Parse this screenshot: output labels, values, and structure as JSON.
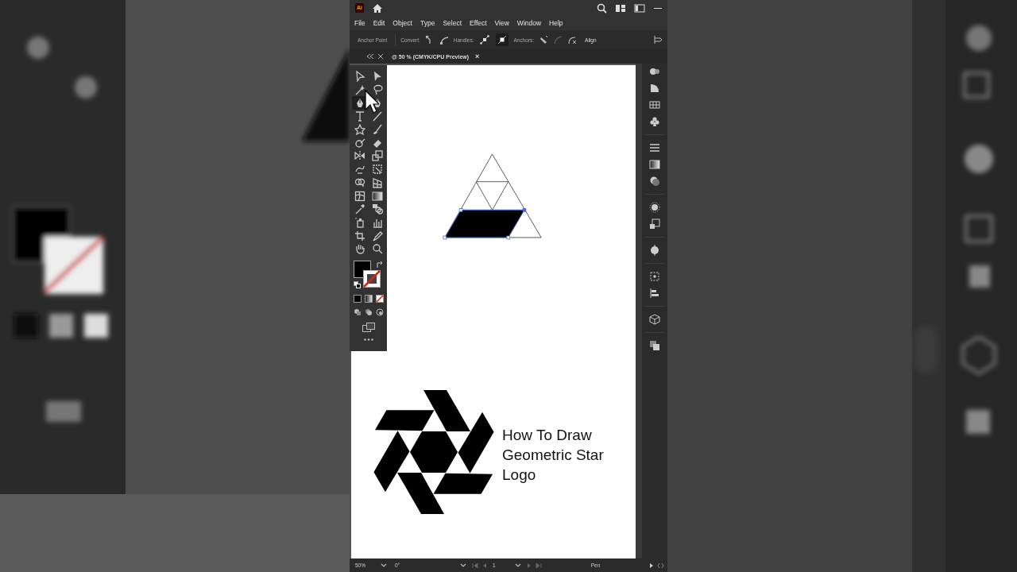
{
  "title_bar": {
    "app_badge": "Ai"
  },
  "menu": [
    "File",
    "Edit",
    "Object",
    "Type",
    "Select",
    "Effect",
    "View",
    "Window",
    "Help"
  ],
  "control_bar": {
    "label": "Anchor Point",
    "convert_label": "Convert:",
    "handles_label": "Handles:",
    "handles": [
      {
        "selected": false
      },
      {
        "selected": true
      }
    ],
    "anchors_label": "Anchors:",
    "align": "Align"
  },
  "document_tab": {
    "title": "@ 50 % (CMYK/CPU Preview)",
    "close": "×"
  },
  "tools": [
    {
      "kind": "selection",
      "selected": false
    },
    {
      "kind": "direct",
      "selected": false
    },
    {
      "kind": "wand",
      "selected": false
    },
    {
      "kind": "lasso",
      "selected": false
    },
    {
      "kind": "pen",
      "selected": true
    },
    {
      "kind": "pen",
      "selected": false
    },
    {
      "kind": "type",
      "selected": false
    },
    {
      "kind": "line",
      "selected": false
    },
    {
      "kind": "star",
      "selected": false
    },
    {
      "kind": "brush",
      "selected": false
    },
    {
      "kind": "shaper",
      "selected": false
    },
    {
      "kind": "eraser",
      "selected": false
    },
    {
      "kind": "reflect",
      "selected": false
    },
    {
      "kind": "scale",
      "selected": false
    },
    {
      "kind": "warp",
      "selected": false
    },
    {
      "kind": "transform",
      "selected": false
    },
    {
      "kind": "builder",
      "selected": false
    },
    {
      "kind": "perspective",
      "selected": false
    },
    {
      "kind": "mesh",
      "selected": false
    },
    {
      "kind": "gradient",
      "selected": false
    },
    {
      "kind": "eyedropper",
      "selected": false
    },
    {
      "kind": "blend",
      "selected": false
    },
    {
      "kind": "sprayer",
      "selected": false
    },
    {
      "kind": "graph",
      "selected": false
    },
    {
      "kind": "artboard",
      "selected": false
    },
    {
      "kind": "knife",
      "selected": false
    },
    {
      "kind": "hand",
      "selected": false
    },
    {
      "kind": "zoom",
      "selected": false
    }
  ],
  "canvas": {
    "title": "How To Draw Geometric Star Logo"
  },
  "status_bar": {
    "zoom": "50%",
    "rotation": "0°",
    "artboard": "1",
    "tool": "Pen"
  }
}
